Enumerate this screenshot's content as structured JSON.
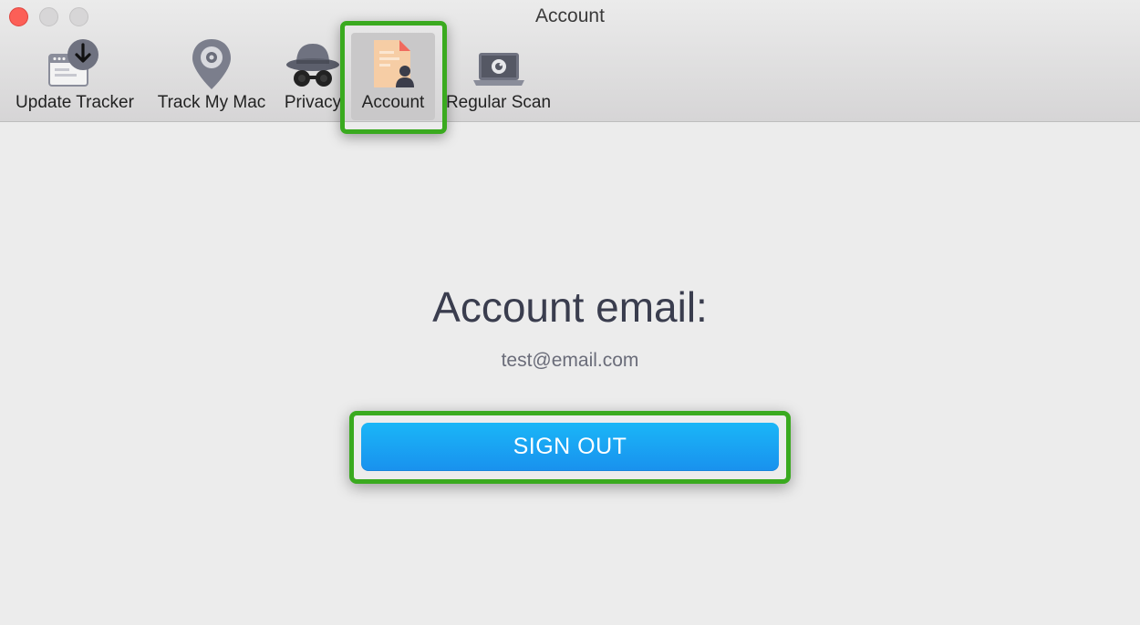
{
  "window": {
    "title": "Account"
  },
  "toolbar": {
    "items": [
      {
        "label": "Update Tracker",
        "icon": "update-tracker-icon"
      },
      {
        "label": "Track My Mac",
        "icon": "map-pin-icon"
      },
      {
        "label": "Privacy",
        "icon": "spy-icon"
      },
      {
        "label": "Account",
        "icon": "account-document-icon",
        "selected": true
      },
      {
        "label": "Regular Scan",
        "icon": "laptop-scan-icon"
      }
    ]
  },
  "main": {
    "heading": "Account email:",
    "email": "test@email.com",
    "signout_label": "SIGN OUT"
  },
  "colors": {
    "highlight": "#3aaa1f",
    "button_top": "#1ab6f7",
    "button_bottom": "#1991ee",
    "close_light": "#fc5f57"
  }
}
